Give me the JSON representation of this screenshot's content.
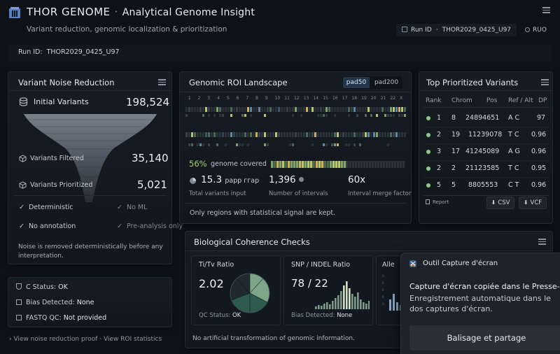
{
  "app": {
    "brand": "THOR GENOME",
    "separator": "·",
    "title": "Analytical Genome Insight",
    "subtitle": "Variant reduction, genomic localization & prioritization",
    "run_chip_label": "Run ID",
    "run_chip_value": "THOR2029_0425_U97",
    "ruo_label": "RUO"
  },
  "run_bar": {
    "label": "Run ID:",
    "value": "THOR2029_0425_U97"
  },
  "noise_panel": {
    "title": "Variant Noise Reduction",
    "initial_label": "Initial Variants",
    "initial_value": "198,524",
    "filtered_label": "Variants Filtered",
    "filtered_value": "35,140",
    "prioritized_label": "Variants Prioritized",
    "prioritized_value": "5,021",
    "checks": [
      {
        "label": "Deterministic",
        "state": "on"
      },
      {
        "label": "No ML",
        "state": "off"
      },
      {
        "label": "No annotation",
        "state": "on"
      },
      {
        "label": "Pre-analysis only",
        "state": "off"
      }
    ],
    "note": "Noise is removed deterministically before any interpretation."
  },
  "status_panel": {
    "rows": [
      {
        "label": "C Status:",
        "value": "OK"
      },
      {
        "label": "Bias Detected:",
        "value": "None"
      },
      {
        "label": "FASTQ QC:",
        "value": "Not provided"
      }
    ]
  },
  "footer_link": "› View noise reduction proof · View ROI statistics",
  "roi_panel": {
    "title": "Genomic ROI Landscape",
    "seg_a": "pad50",
    "seg_b": "pad200",
    "chrom_labels": [
      "1",
      "2",
      "3",
      "4",
      "5",
      "6",
      "7",
      "8",
      "9",
      "10",
      "11",
      "12",
      "13",
      "14",
      "15",
      "16",
      "17",
      "18",
      "19",
      "20",
      "21",
      "22",
      "X"
    ],
    "coverage_pct": "56%",
    "coverage_label": "genome covered",
    "coverage_fraction": 0.56,
    "stat1_value": "15.3",
    "stat1_suffix": "рарр ггар",
    "stat1_label": "Total variants input",
    "stat2_value": "1,396",
    "stat2_label": "Number of intervals",
    "stat3_value": "60x",
    "stat3_label": "Interval merge factor",
    "note": "Only regions with statistical signal are kept."
  },
  "top_panel": {
    "title": "Top Prioritized Variants",
    "headers": [
      "Rank",
      "Chrom",
      "Pos",
      "Ref / Alt",
      "DP"
    ],
    "rows": [
      {
        "rank": "1",
        "chrom": "8",
        "pos": "24894651",
        "refalt": "A C",
        "dp": "97"
      },
      {
        "rank": "2",
        "chrom": "19",
        "pos": "11239078",
        "refalt": "T C",
        "dp": "0.96"
      },
      {
        "rank": "3",
        "chrom": "17",
        "pos": "41245089",
        "refalt": "A G",
        "dp": "0.96"
      },
      {
        "rank": "2",
        "chrom": "2",
        "pos": "21123585",
        "refalt": "T C",
        "dp": "0.95"
      },
      {
        "rank": "5",
        "chrom": "5",
        "pos": "8805553",
        "refalt": "C T",
        "dp": "0.96"
      }
    ],
    "report_label": "Report",
    "csv_label": "CSV",
    "vcf_label": "VCF"
  },
  "bio_panel": {
    "title": "Biological Coherence Checks",
    "titv_title": "Ti/Tv Ratio",
    "titv_value": "2.02",
    "titv_status_label": "QC Status:",
    "titv_status_value": "OK",
    "snp_title": "SNP / INDEL Ratio",
    "snp_value": "78 / 22",
    "snp_status_label": "Bias Detected:",
    "snp_status_value": "None",
    "allele_title": "Alle",
    "note": "No artificial transformation of genomic information."
  },
  "toast": {
    "app_name": "Outil Capture d'écran",
    "headline": "Capture d'écran copiée dans le Presse-pa",
    "body": "Enregistrement automatique dans le dos captures d'écran.",
    "button": "Balisage et partage"
  },
  "colors": {
    "background": "#0e1217",
    "accent_green": "#8fc98a",
    "teal": "#3b6f66",
    "blue_accent": "#24364a"
  }
}
